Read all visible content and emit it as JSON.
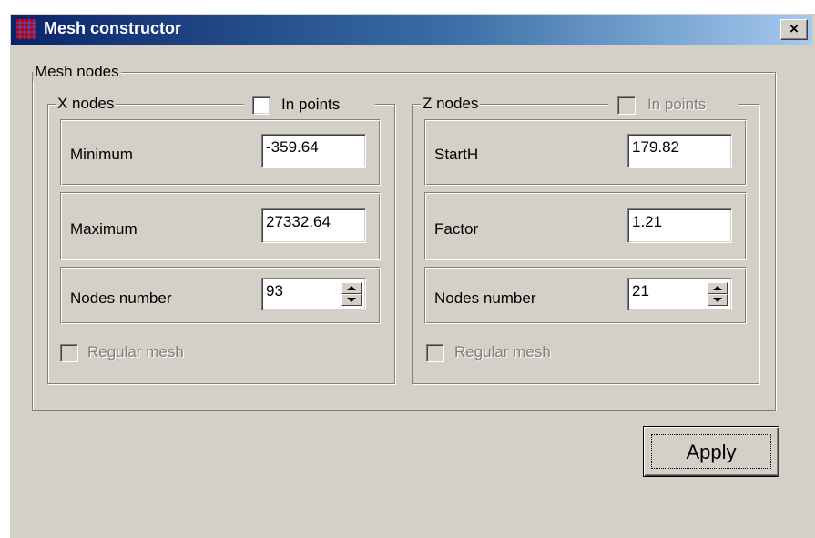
{
  "window": {
    "title": "Mesh constructor",
    "close_glyph": "×",
    "icon": "grid-icon"
  },
  "mesh_nodes": {
    "label": "Mesh nodes",
    "x_nodes": {
      "label": "X nodes",
      "in_points": {
        "label": "In points",
        "checked": false,
        "enabled": true
      },
      "minimum": {
        "label": "Minimum",
        "value": "-359.64"
      },
      "maximum": {
        "label": "Maximum",
        "value": "27332.64"
      },
      "nodes_number": {
        "label": "Nodes number",
        "value": "93"
      },
      "regular_mesh": {
        "label": "Regular mesh",
        "checked": false,
        "enabled": false
      }
    },
    "z_nodes": {
      "label": "Z nodes",
      "in_points": {
        "label": "In points",
        "checked": false,
        "enabled": false
      },
      "start_h": {
        "label": "StartH",
        "value": "179.82"
      },
      "factor": {
        "label": "Factor",
        "value": "1.21"
      },
      "nodes_number": {
        "label": "Nodes number",
        "value": "21"
      },
      "regular_mesh": {
        "label": "Regular mesh",
        "checked": false,
        "enabled": false
      }
    }
  },
  "apply_button": {
    "label": "Apply"
  },
  "colors": {
    "face": "#d4d0c8",
    "title_start": "#0a246a",
    "title_end": "#a6caf0",
    "disabled_text": "#808080"
  }
}
